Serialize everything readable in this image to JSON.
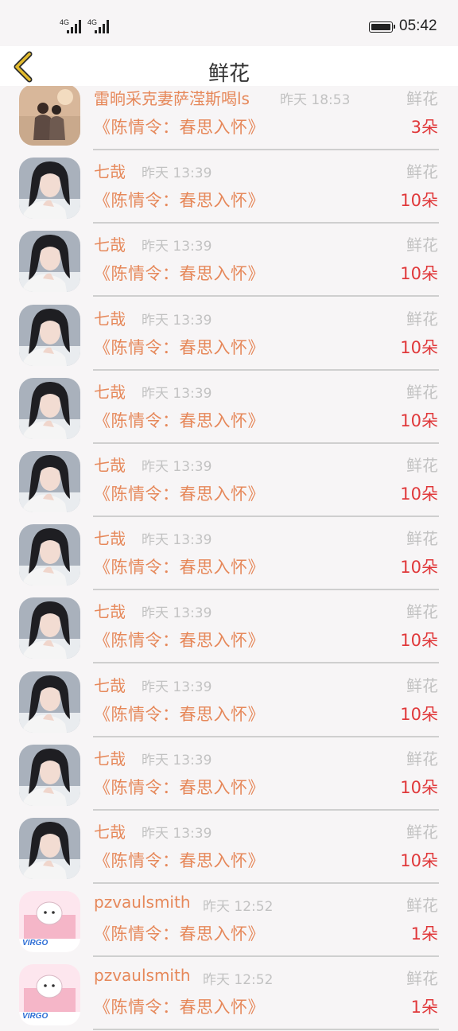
{
  "status_bar": {
    "signal1": "4G",
    "signal2": "4G",
    "time": "05:42"
  },
  "header": {
    "title": "鲜花",
    "back_icon": "chevron-left-icon"
  },
  "colors": {
    "name": "#e6885a",
    "count": "#e0383a",
    "meta": "#c2c2c2",
    "back_icon": "#e3bb2e"
  },
  "records": [
    {
      "user": "雷晌采克妻萨滢斯喝ls",
      "time": "昨天 18:53",
      "gift": "鲜花",
      "drama": "《陈情令：春思入怀》",
      "count": "3朵",
      "avatar": "couple"
    },
    {
      "user": "七哉",
      "time": "昨天 13:39",
      "gift": "鲜花",
      "drama": "《陈情令：春思入怀》",
      "count": "10朵",
      "avatar": "actor"
    },
    {
      "user": "七哉",
      "time": "昨天 13:39",
      "gift": "鲜花",
      "drama": "《陈情令：春思入怀》",
      "count": "10朵",
      "avatar": "actor"
    },
    {
      "user": "七哉",
      "time": "昨天 13:39",
      "gift": "鲜花",
      "drama": "《陈情令：春思入怀》",
      "count": "10朵",
      "avatar": "actor"
    },
    {
      "user": "七哉",
      "time": "昨天 13:39",
      "gift": "鲜花",
      "drama": "《陈情令：春思入怀》",
      "count": "10朵",
      "avatar": "actor"
    },
    {
      "user": "七哉",
      "time": "昨天 13:39",
      "gift": "鲜花",
      "drama": "《陈情令：春思入怀》",
      "count": "10朵",
      "avatar": "actor"
    },
    {
      "user": "七哉",
      "time": "昨天 13:39",
      "gift": "鲜花",
      "drama": "《陈情令：春思入怀》",
      "count": "10朵",
      "avatar": "actor"
    },
    {
      "user": "七哉",
      "time": "昨天 13:39",
      "gift": "鲜花",
      "drama": "《陈情令：春思入怀》",
      "count": "10朵",
      "avatar": "actor"
    },
    {
      "user": "七哉",
      "time": "昨天 13:39",
      "gift": "鲜花",
      "drama": "《陈情令：春思入怀》",
      "count": "10朵",
      "avatar": "actor"
    },
    {
      "user": "七哉",
      "time": "昨天 13:39",
      "gift": "鲜花",
      "drama": "《陈情令：春思入怀》",
      "count": "10朵",
      "avatar": "actor"
    },
    {
      "user": "七哉",
      "time": "昨天 13:39",
      "gift": "鲜花",
      "drama": "《陈情令：春思入怀》",
      "count": "10朵",
      "avatar": "actor"
    },
    {
      "user": "pzvaulsmith",
      "time": "昨天 12:52",
      "gift": "鲜花",
      "drama": "《陈情令：春思入怀》",
      "count": "1朵",
      "avatar": "cartoon",
      "avatar_text": "VIRGO"
    },
    {
      "user": "pzvaulsmith",
      "time": "昨天 12:52",
      "gift": "鲜花",
      "drama": "《陈情令：春思入怀》",
      "count": "1朵",
      "avatar": "cartoon",
      "avatar_text": "VIRGO"
    }
  ]
}
